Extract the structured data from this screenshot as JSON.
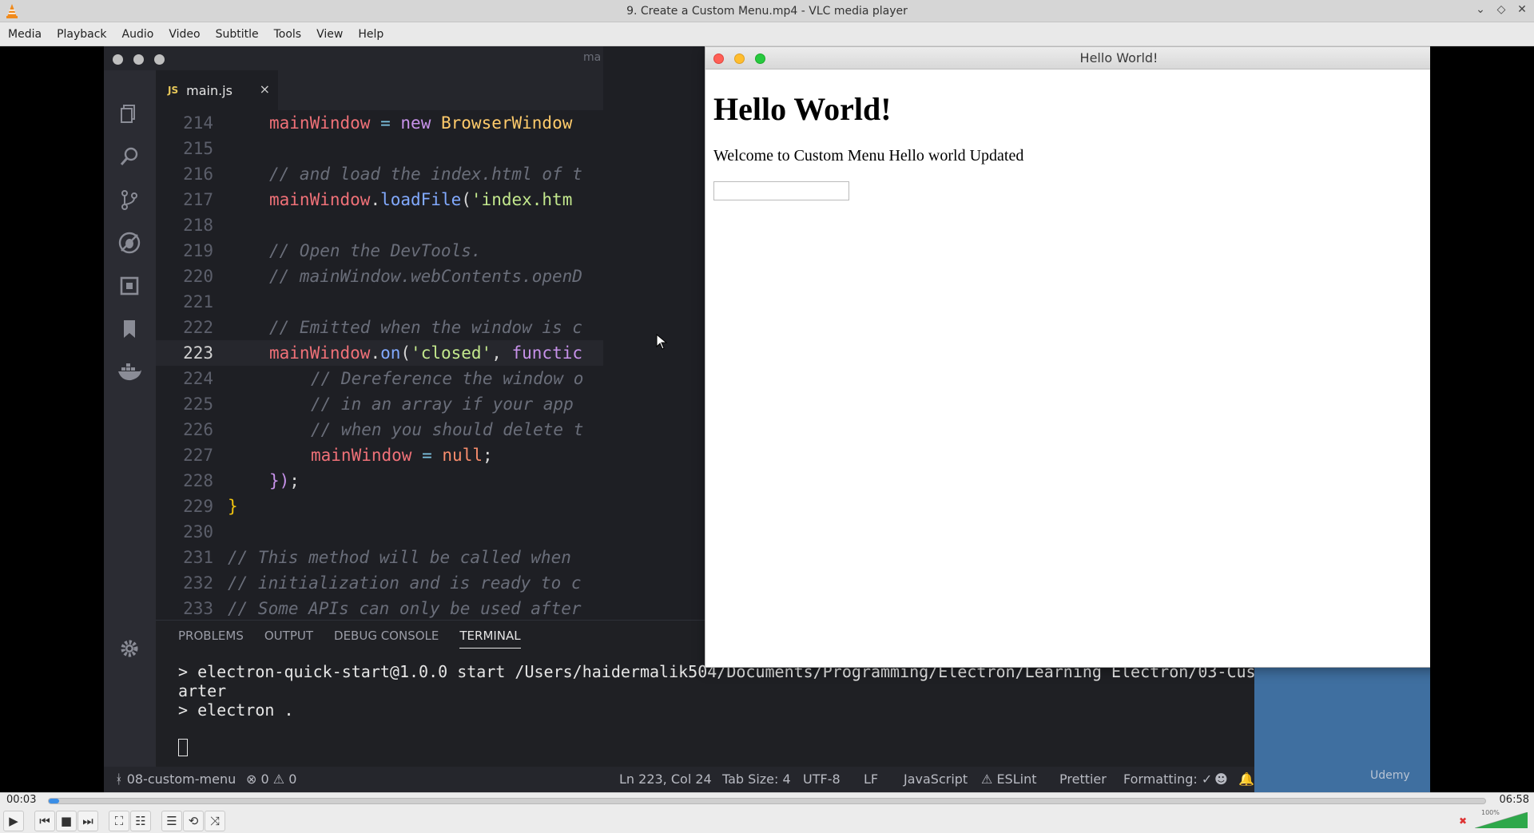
{
  "window": {
    "title": "9. Create a Custom Menu.mp4 - VLC media player",
    "controls": [
      "⌄",
      "◇",
      "✕"
    ]
  },
  "menubar": [
    "Media",
    "Playback",
    "Audio",
    "Video",
    "Subtitle",
    "Tools",
    "View",
    "Help"
  ],
  "video": {
    "vscode": {
      "title_fragment": "ma",
      "activity_icons": [
        "files-icon",
        "search-icon",
        "source-control-icon",
        "debug-icon",
        "extensions-icon",
        "bookmark-icon",
        "docker-icon",
        "settings-gear-icon"
      ],
      "tab": {
        "badge": "JS",
        "name": "main.js",
        "close": "×"
      },
      "code_lines": [
        {
          "n": "214",
          "text": "mainWindow = new BrowserWindow"
        },
        {
          "n": "215",
          "text": ""
        },
        {
          "n": "216",
          "text": "// and load the index.html of t"
        },
        {
          "n": "217",
          "text": "mainWindow.loadFile('index.htm"
        },
        {
          "n": "218",
          "text": ""
        },
        {
          "n": "219",
          "text": "// Open the DevTools."
        },
        {
          "n": "220",
          "text": "// mainWindow.webContents.openD"
        },
        {
          "n": "221",
          "text": ""
        },
        {
          "n": "222",
          "text": "// Emitted when the window is c"
        },
        {
          "n": "223",
          "text": "mainWindow.on('closed', functic"
        },
        {
          "n": "224",
          "text": "// Dereference the window o"
        },
        {
          "n": "225",
          "text": "// in an array if your app"
        },
        {
          "n": "226",
          "text": "// when you should delete t"
        },
        {
          "n": "227",
          "text": "mainWindow = null;"
        },
        {
          "n": "228",
          "text": "});"
        },
        {
          "n": "229",
          "text": "}"
        },
        {
          "n": "230",
          "text": ""
        },
        {
          "n": "231",
          "text": "// This method will be called when"
        },
        {
          "n": "232",
          "text": "// initialization and is ready to c"
        },
        {
          "n": "233",
          "text": "// Some APIs can only be used after"
        }
      ],
      "panel_tabs": [
        "PROBLEMS",
        "OUTPUT",
        "DEBUG CONSOLE",
        "TERMINAL"
      ],
      "active_panel_tab": "TERMINAL",
      "terminal": [
        "> electron-quick-start@1.0.0 start /Users/haidermalik504/Documents/Programming/Electron/Learning Electron/03-Cus",
        "arter",
        "> electron ."
      ],
      "status": {
        "branch": "08-custom-menu",
        "errors": "0",
        "warnings": "0",
        "position": "Ln 223, Col 24",
        "tab_size": "Tab Size: 4",
        "encoding": "UTF-8",
        "eol": "LF",
        "language": "JavaScript",
        "eslint": "ESLint",
        "prettier": "Prettier",
        "formatting": "Formatting: ✓"
      },
      "watermark": "Udemy"
    },
    "electron_window": {
      "title": "Hello World!",
      "heading": "Hello World!",
      "paragraph": "Welcome to Custom Menu Hello world Updated",
      "input_value": ""
    }
  },
  "player": {
    "elapsed": "00:03",
    "total": "06:58",
    "progress_fraction": 0.007,
    "volume_label": "100%",
    "volume_fraction": 1.0
  }
}
